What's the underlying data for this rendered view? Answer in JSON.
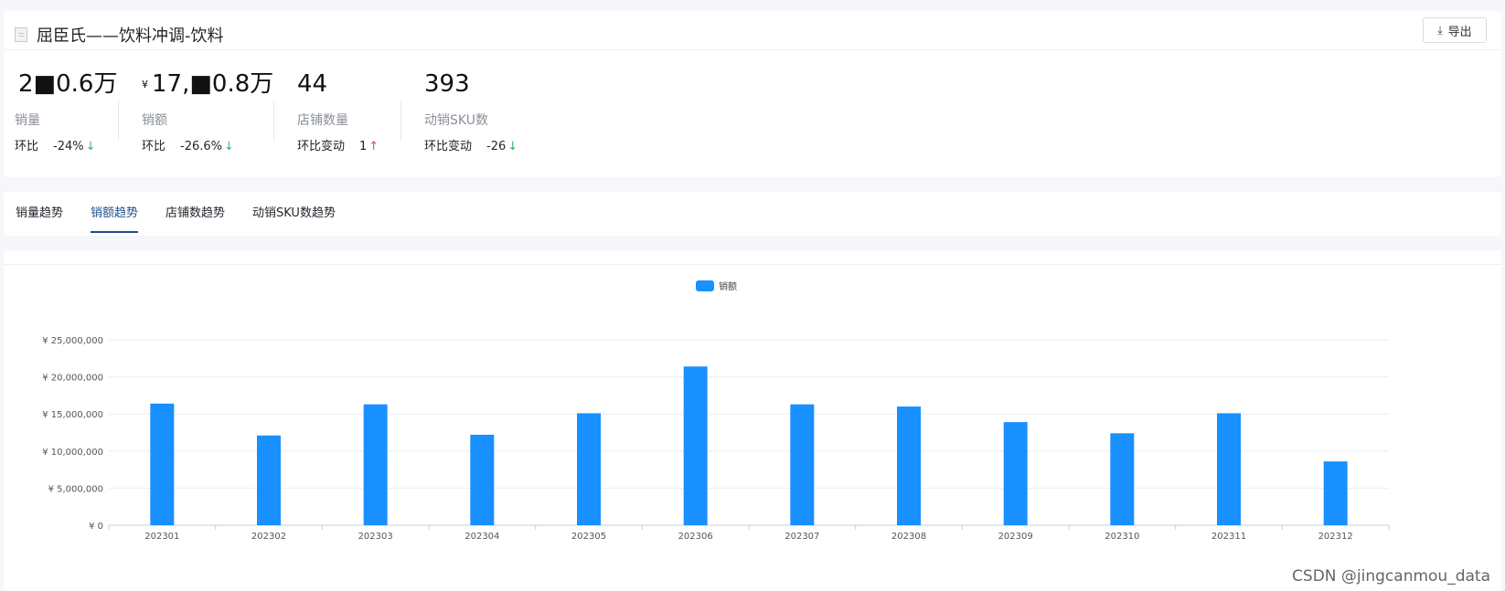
{
  "header": {
    "title": "屈臣氏——饮料冲调-饮料",
    "export_label": "导出",
    "export_icon": "download-icon"
  },
  "metrics": [
    {
      "value": "2■0.6万",
      "currency": "",
      "label": "销量",
      "compare_label": "环比",
      "compare_value": "-24%",
      "trend": "down"
    },
    {
      "value": "17,■0.8万",
      "currency": "¥",
      "label": "销额",
      "compare_label": "环比",
      "compare_value": "-26.6%",
      "trend": "down"
    },
    {
      "value": "44",
      "currency": "",
      "label": "店铺数量",
      "compare_label": "环比变动",
      "compare_value": "1",
      "trend": "up"
    },
    {
      "value": "393",
      "currency": "",
      "label": "动销SKU数",
      "compare_label": "环比变动",
      "compare_value": "-26",
      "trend": "down"
    }
  ],
  "tabs": [
    {
      "label": "销量趋势",
      "active": false
    },
    {
      "label": "销额趋势",
      "active": true
    },
    {
      "label": "店铺数趋势",
      "active": false
    },
    {
      "label": "动销SKU数趋势",
      "active": false
    }
  ],
  "chart_data": {
    "type": "bar",
    "categories": [
      "202301",
      "202302",
      "202303",
      "202304",
      "202305",
      "202306",
      "202307",
      "202308",
      "202309",
      "202310",
      "202311",
      "202312"
    ],
    "series": [
      {
        "name": "销额",
        "values": [
          16400000,
          12100000,
          16300000,
          12200000,
          15100000,
          21400000,
          16300000,
          16000000,
          13900000,
          12400000,
          15100000,
          8600000
        ],
        "color": "#1890ff"
      }
    ],
    "y_ticks": [
      "¥ 0",
      "¥ 5,000,000",
      "¥ 10,000,000",
      "¥ 15,000,000",
      "¥ 20,000,000",
      "¥ 25,000,000"
    ],
    "ylim": [
      0,
      25000000
    ],
    "legend_position": "top-center",
    "grid": true
  },
  "watermark": "CSDN @jingcanmou_data"
}
